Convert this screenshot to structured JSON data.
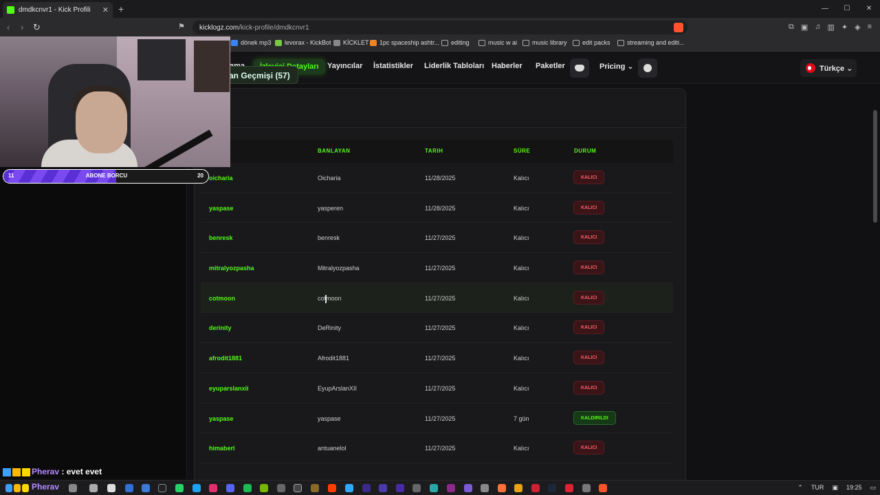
{
  "browser": {
    "tab_title": "dmdkcnvr1 - Kick Profili",
    "tab_close": "✕",
    "new_tab": "+",
    "window_controls": [
      "—",
      "☐",
      "✕"
    ],
    "url_host": "kicklogz.com",
    "url_path": "/kick-profile/dmdkcnvr1",
    "bookmarks": [
      "dönek mp3",
      "levorax - KickBot",
      "KİCKLET",
      "1pc spaceship ashtr...",
      "editing",
      "music w ai",
      "music library",
      "edit packs",
      "streaming and editi..."
    ]
  },
  "nav": {
    "partial_item": "ama",
    "items": [
      "İzleyici Detayları",
      "Yayıncılar",
      "İstatistikler",
      "Liderlik Tabloları",
      "Haberler",
      "Paketler"
    ],
    "pricing": "Pricing ⌄",
    "language": "Türkçe ⌄"
  },
  "section": {
    "ban_history_label": "an Geçmişi (57)"
  },
  "table": {
    "headers": [
      "BANLAYAN",
      "TARIH",
      "SÜRE",
      "DURUM"
    ],
    "rows": [
      {
        "user": "oicharia",
        "by": "Oicharia",
        "date": "11/28/2025",
        "duration": "Kalıcı",
        "status": "KALICI"
      },
      {
        "user": "yaspase",
        "by": "yasperen",
        "date": "11/28/2025",
        "duration": "Kalıcı",
        "status": "KALICI"
      },
      {
        "user": "benresk",
        "by": "benresk",
        "date": "11/27/2025",
        "duration": "Kalıcı",
        "status": "KALICI"
      },
      {
        "user": "mitralyozpasha",
        "by": "Mitralyozpasha",
        "date": "11/27/2025",
        "duration": "Kalıcı",
        "status": "KALICI"
      },
      {
        "user": "cotmoon",
        "by": "cotmoon",
        "date": "11/27/2025",
        "duration": "Kalıcı",
        "status": "KALICI"
      },
      {
        "user": "derinity",
        "by": "DeRinity",
        "date": "11/27/2025",
        "duration": "Kalıcı",
        "status": "KALICI"
      },
      {
        "user": "afrodit1881",
        "by": "Afrodit1881",
        "date": "11/27/2025",
        "duration": "Kalıcı",
        "status": "KALICI"
      },
      {
        "user": "eyuparslanxii",
        "by": "EyupArslanXII",
        "date": "11/27/2025",
        "duration": "Kalıcı",
        "status": "KALICI"
      },
      {
        "user": "yaspase",
        "by": "yaspase",
        "date": "11/27/2025",
        "duration": "7 gün",
        "status": "KALDIRILDI"
      },
      {
        "user": "himaberl",
        "by": "antuanelol",
        "date": "11/27/2025",
        "duration": "Kalıcı",
        "status": "KALICI"
      }
    ]
  },
  "overlay": {
    "subbar_left": "11",
    "subbar_title": "ABONE BORCU",
    "subbar_right": "20",
    "subbar_fill": 0.55,
    "chat_name": "Pherav",
    "chat_message": " : evet evet",
    "chat_name2": "Pherav"
  },
  "taskbar": {
    "lang": "TUR",
    "time": "19:25"
  },
  "colors": {
    "accent": "#53fc18",
    "danger": "#ff5c6c",
    "sub_purple": "#5b2fd6"
  }
}
